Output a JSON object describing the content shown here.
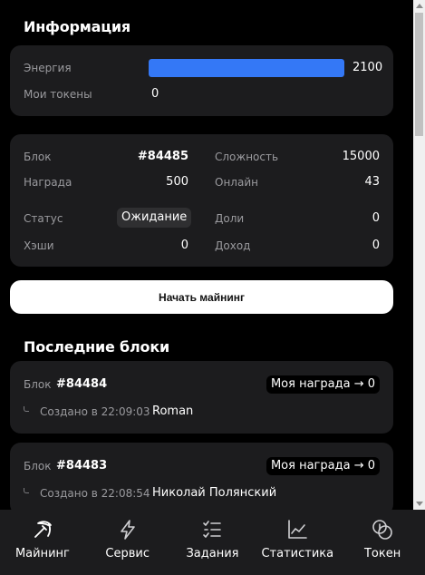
{
  "info": {
    "title": "Информация",
    "energy_label": "Энергия",
    "energy_value": "2100",
    "energy_fill": 1.0,
    "tokens_label": "Мои токены",
    "tokens_value": "0"
  },
  "stats": {
    "block_label": "Блок",
    "block_value": "#84485",
    "difficulty_label": "Сложность",
    "difficulty_value": "15000",
    "reward_label": "Награда",
    "reward_value": "500",
    "online_label": "Онлайн",
    "online_value": "43",
    "status_label": "Статус",
    "status_value": "Ожидание",
    "shares_label": "Доли",
    "shares_value": "0",
    "hashes_label": "Хэши",
    "hashes_value": "0",
    "income_label": "Доход",
    "income_value": "0"
  },
  "start_button": "Начать майнинг",
  "recent": {
    "title": "Последние блоки",
    "items": [
      {
        "block_label": "Блок",
        "number": "#84484",
        "reward": "Моя награда → 0",
        "created": "Создано в 22:09:03",
        "author": "Roman"
      },
      {
        "block_label": "Блок",
        "number": "#84483",
        "reward": "Моя награда → 0",
        "created": "Создано в 22:08:54",
        "author": "Николай Полянский"
      }
    ]
  },
  "nav": [
    {
      "label": "Майнинг",
      "icon": "pickaxe-icon",
      "active": true
    },
    {
      "label": "Сервис",
      "icon": "lightning-icon",
      "active": false
    },
    {
      "label": "Задания",
      "icon": "checklist-icon",
      "active": false
    },
    {
      "label": "Статистика",
      "icon": "chart-icon",
      "active": false
    },
    {
      "label": "Токен",
      "icon": "coins-icon",
      "active": false
    }
  ],
  "colors": {
    "accent": "#3478f6",
    "card": "#1c1c1e",
    "background": "#000000"
  }
}
